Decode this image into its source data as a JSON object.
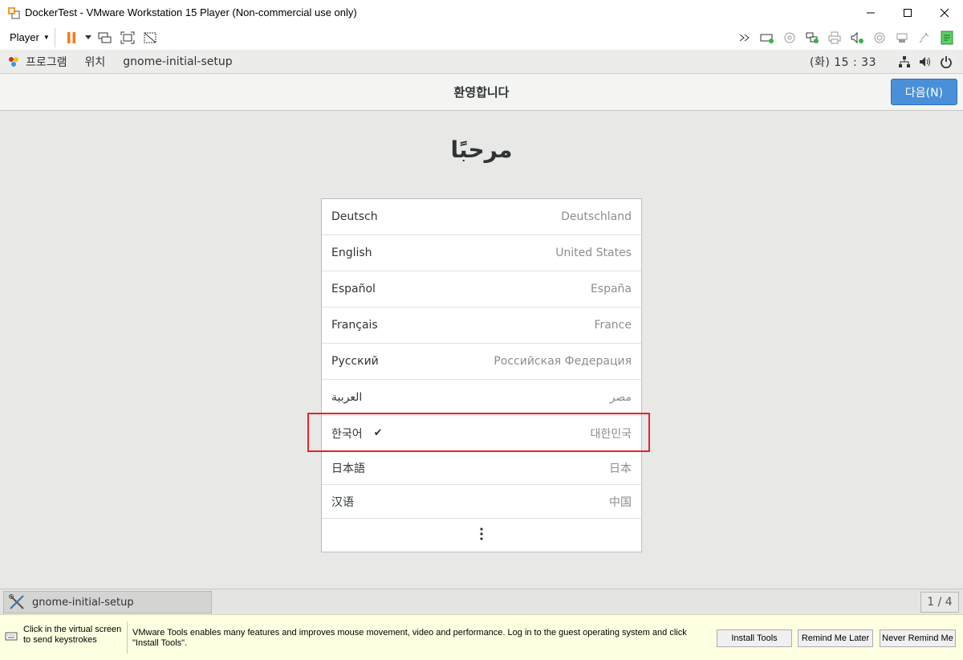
{
  "window": {
    "title": "DockerTest - VMware Workstation 15 Player (Non-commercial use only)",
    "controls": [
      "minimize",
      "maximize",
      "close"
    ]
  },
  "toolbar": {
    "player_label": "Player",
    "left_icons": [
      "pause-icon",
      "send-ctrl-alt-del-icon",
      "fit-guest-icon",
      "unity-icon"
    ],
    "right_icons": [
      "expand-icon",
      "hard-disk-icon",
      "cd-icon",
      "network-icon",
      "printer-icon",
      "sound-icon",
      "usb-icon",
      "usb-device-icon",
      "message-log-icon"
    ]
  },
  "gnome_panel": {
    "menu_programs": "프로그램",
    "menu_places": "위치",
    "app_name": "gnome-initial-setup",
    "clock": "(화) 15 : 33"
  },
  "setup": {
    "title": "환영합니다",
    "next_button": "다음(N)",
    "welcome_heading": "مرحبًا",
    "languages": [
      {
        "name": "Deutsch",
        "region": "Deutschland",
        "selected": false
      },
      {
        "name": "English",
        "region": "United States",
        "selected": false
      },
      {
        "name": "Español",
        "region": "España",
        "selected": false
      },
      {
        "name": "Français",
        "region": "France",
        "selected": false
      },
      {
        "name": "Русский",
        "region": "Российская Федерация",
        "selected": false
      },
      {
        "name": "العربية",
        "region": "مصر",
        "selected": false
      },
      {
        "name": "한국어",
        "region": "대한민국",
        "selected": true
      },
      {
        "name": "日本語",
        "region": "日本",
        "selected": false
      },
      {
        "name": "汉语",
        "region": "中国",
        "selected": false
      }
    ],
    "more_icon": "more-vertical-icon",
    "checkmark": "✔"
  },
  "taskbar": {
    "task_label": "gnome-initial-setup",
    "workspace": "1 / 4"
  },
  "hint_bar": {
    "click_hint": "Click in the virtual screen to send keystrokes",
    "tools_message": "VMware Tools enables many features and improves mouse movement, video and performance. Log in to the guest operating system and click \"Install Tools\".",
    "install_button": "Install Tools",
    "remind_button": "Remind Me Later",
    "never_button": "Never Remind Me"
  },
  "colors": {
    "accent_button": "#4a90d9",
    "highlight_border": "#e0242b",
    "hint_background": "#ffffe1"
  }
}
